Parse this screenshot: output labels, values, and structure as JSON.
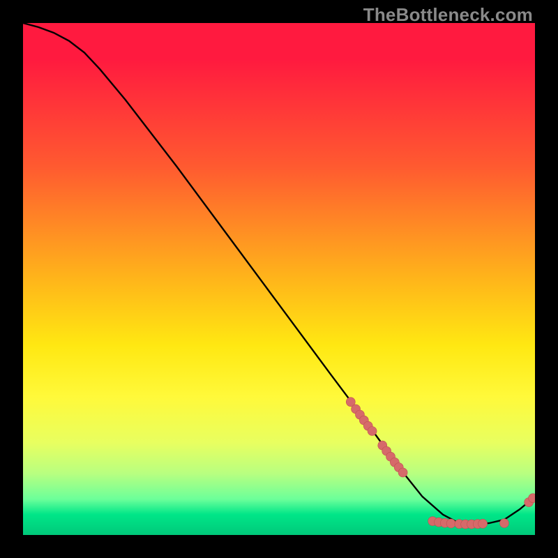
{
  "watermark": "TheBottleneck.com",
  "colors": {
    "curve_stroke": "#000000",
    "point_fill": "#d66a6a",
    "point_stroke": "#c05050"
  },
  "chart_data": {
    "type": "line",
    "title": "",
    "xlabel": "",
    "ylabel": "",
    "xlim": [
      0,
      100
    ],
    "ylim": [
      0,
      100
    ],
    "grid": false,
    "curve": [
      {
        "x": 0,
        "y": 100.0
      },
      {
        "x": 3,
        "y": 99.2
      },
      {
        "x": 6,
        "y": 98.1
      },
      {
        "x": 9,
        "y": 96.5
      },
      {
        "x": 12,
        "y": 94.2
      },
      {
        "x": 15,
        "y": 91.0
      },
      {
        "x": 20,
        "y": 85.0
      },
      {
        "x": 30,
        "y": 72.0
      },
      {
        "x": 40,
        "y": 58.5
      },
      {
        "x": 50,
        "y": 45.0
      },
      {
        "x": 60,
        "y": 31.5
      },
      {
        "x": 66,
        "y": 23.5
      },
      {
        "x": 70,
        "y": 18.0
      },
      {
        "x": 74,
        "y": 12.5
      },
      {
        "x": 78,
        "y": 7.5
      },
      {
        "x": 82,
        "y": 4.0
      },
      {
        "x": 85,
        "y": 2.4
      },
      {
        "x": 88,
        "y": 2.1
      },
      {
        "x": 91,
        "y": 2.3
      },
      {
        "x": 94,
        "y": 3.0
      },
      {
        "x": 97,
        "y": 5.0
      },
      {
        "x": 100,
        "y": 7.5
      }
    ],
    "points": [
      {
        "x": 64.0,
        "y": 26.0
      },
      {
        "x": 65.0,
        "y": 24.6
      },
      {
        "x": 65.8,
        "y": 23.5
      },
      {
        "x": 66.6,
        "y": 22.4
      },
      {
        "x": 67.4,
        "y": 21.3
      },
      {
        "x": 68.2,
        "y": 20.3
      },
      {
        "x": 70.2,
        "y": 17.5
      },
      {
        "x": 71.0,
        "y": 16.4
      },
      {
        "x": 71.8,
        "y": 15.3
      },
      {
        "x": 72.6,
        "y": 14.2
      },
      {
        "x": 73.4,
        "y": 13.2
      },
      {
        "x": 74.2,
        "y": 12.2
      },
      {
        "x": 80.0,
        "y": 2.7
      },
      {
        "x": 81.2,
        "y": 2.5
      },
      {
        "x": 82.4,
        "y": 2.35
      },
      {
        "x": 83.6,
        "y": 2.25
      },
      {
        "x": 85.2,
        "y": 2.15
      },
      {
        "x": 86.4,
        "y": 2.1
      },
      {
        "x": 87.6,
        "y": 2.1
      },
      {
        "x": 88.8,
        "y": 2.15
      },
      {
        "x": 89.8,
        "y": 2.2
      },
      {
        "x": 94.0,
        "y": 2.3
      },
      {
        "x": 98.8,
        "y": 6.4
      },
      {
        "x": 99.6,
        "y": 7.2
      }
    ]
  }
}
